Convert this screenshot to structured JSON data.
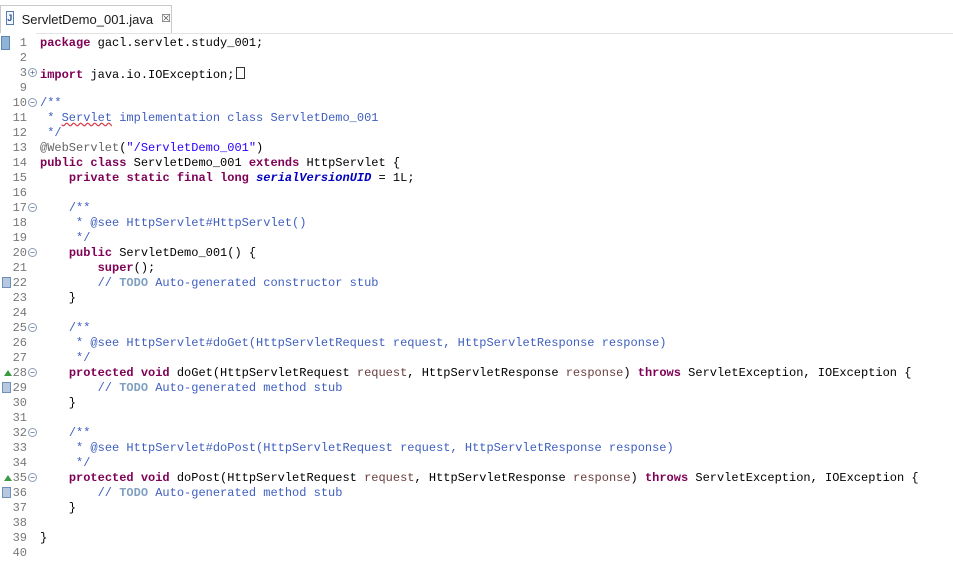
{
  "tab": {
    "label": "ServletDemo_001.java",
    "close": "☒"
  },
  "lines": [
    {
      "n": "1",
      "parts": [
        [
          "kw",
          "package"
        ],
        [
          "",
          "gacl.servlet.study_001;"
        ]
      ]
    },
    {
      "n": "2",
      "parts": []
    },
    {
      "n": "3",
      "parts": [
        [
          "kw",
          "import"
        ],
        [
          "",
          " java.io.IOException;"
        ]
      ],
      "box": true
    },
    {
      "n": "9",
      "parts": []
    },
    {
      "n": "10",
      "parts": [
        [
          "cm",
          "/**"
        ]
      ]
    },
    {
      "n": "11",
      "parts": [
        [
          "cm",
          " * "
        ],
        [
          "cm-err",
          "Servlet"
        ],
        [
          "cm",
          " implementation class ServletDemo_001"
        ]
      ]
    },
    {
      "n": "12",
      "parts": [
        [
          "cm",
          " */"
        ]
      ]
    },
    {
      "n": "13",
      "parts": [
        [
          "ann",
          "@WebServlet"
        ],
        [
          "",
          "("
        ],
        [
          "str",
          "\"/ServletDemo_001\""
        ],
        [
          "",
          ")"
        ]
      ]
    },
    {
      "n": "14",
      "parts": [
        [
          "kw",
          "public"
        ],
        [
          "",
          " "
        ],
        [
          "kw",
          "class"
        ],
        [
          "",
          " ServletDemo_001 "
        ],
        [
          "kw",
          "extends"
        ],
        [
          "",
          " HttpServlet {"
        ]
      ]
    },
    {
      "n": "15",
      "parts": [
        [
          "",
          "    "
        ],
        [
          "kw",
          "private"
        ],
        [
          "",
          " "
        ],
        [
          "kw",
          "static"
        ],
        [
          "",
          " "
        ],
        [
          "kw",
          "final"
        ],
        [
          "",
          " "
        ],
        [
          "kw",
          "long"
        ],
        [
          "",
          " "
        ],
        [
          "fld",
          "serialVersionUID"
        ],
        [
          "",
          " = 1L;"
        ]
      ]
    },
    {
      "n": "16",
      "parts": []
    },
    {
      "n": "17",
      "parts": [
        [
          "",
          "    "
        ],
        [
          "cm",
          "/**"
        ]
      ]
    },
    {
      "n": "18",
      "parts": [
        [
          "",
          "    "
        ],
        [
          "cm",
          " * @see HttpServlet#HttpServlet()"
        ]
      ]
    },
    {
      "n": "19",
      "parts": [
        [
          "",
          "    "
        ],
        [
          "cm",
          " */"
        ]
      ]
    },
    {
      "n": "20",
      "parts": [
        [
          "",
          "    "
        ],
        [
          "kw",
          "public"
        ],
        [
          "",
          " ServletDemo_001() {"
        ]
      ]
    },
    {
      "n": "21",
      "parts": [
        [
          "",
          "        "
        ],
        [
          "kw",
          "super"
        ],
        [
          "",
          "();"
        ]
      ]
    },
    {
      "n": "22",
      "parts": [
        [
          "",
          "        "
        ],
        [
          "cm",
          "// "
        ],
        [
          "todo",
          "TODO"
        ],
        [
          "cm",
          " Auto-generated constructor stub"
        ]
      ]
    },
    {
      "n": "23",
      "parts": [
        [
          "",
          "    }"
        ]
      ]
    },
    {
      "n": "24",
      "parts": []
    },
    {
      "n": "25",
      "parts": [
        [
          "",
          "    "
        ],
        [
          "cm",
          "/**"
        ]
      ]
    },
    {
      "n": "26",
      "parts": [
        [
          "",
          "    "
        ],
        [
          "cm",
          " * @see HttpServlet#doGet(HttpServletRequest request, HttpServletResponse response)"
        ]
      ]
    },
    {
      "n": "27",
      "parts": [
        [
          "",
          "    "
        ],
        [
          "cm",
          " */"
        ]
      ]
    },
    {
      "n": "28",
      "parts": [
        [
          "",
          "    "
        ],
        [
          "kw",
          "protected"
        ],
        [
          "",
          " "
        ],
        [
          "kw",
          "void"
        ],
        [
          "",
          " doGet(HttpServletRequest "
        ],
        [
          "prm",
          "request"
        ],
        [
          "",
          ", HttpServletResponse "
        ],
        [
          "prm",
          "response"
        ],
        [
          "",
          ") "
        ],
        [
          "kw",
          "throws"
        ],
        [
          "",
          " ServletException, IOException {"
        ]
      ]
    },
    {
      "n": "29",
      "parts": [
        [
          "",
          "        "
        ],
        [
          "cm",
          "// "
        ],
        [
          "todo",
          "TODO"
        ],
        [
          "cm",
          " Auto-generated method stub"
        ]
      ]
    },
    {
      "n": "30",
      "parts": [
        [
          "",
          "    }"
        ]
      ]
    },
    {
      "n": "31",
      "parts": []
    },
    {
      "n": "32",
      "parts": [
        [
          "",
          "    "
        ],
        [
          "cm",
          "/**"
        ]
      ]
    },
    {
      "n": "33",
      "parts": [
        [
          "",
          "    "
        ],
        [
          "cm",
          " * @see HttpServlet#doPost(HttpServletRequest request, HttpServletResponse response)"
        ]
      ]
    },
    {
      "n": "34",
      "parts": [
        [
          "",
          "    "
        ],
        [
          "cm",
          " */"
        ]
      ]
    },
    {
      "n": "35",
      "parts": [
        [
          "",
          "    "
        ],
        [
          "kw",
          "protected"
        ],
        [
          "",
          " "
        ],
        [
          "kw",
          "void"
        ],
        [
          "",
          " doPost(HttpServletRequest "
        ],
        [
          "prm",
          "request"
        ],
        [
          "",
          ", HttpServletResponse "
        ],
        [
          "prm",
          "response"
        ],
        [
          "",
          ") "
        ],
        [
          "kw",
          "throws"
        ],
        [
          "",
          " ServletException, IOException {"
        ]
      ]
    },
    {
      "n": "36",
      "parts": [
        [
          "",
          "        "
        ],
        [
          "cm",
          "// "
        ],
        [
          "todo",
          "TODO"
        ],
        [
          "cm",
          " Auto-generated method stub"
        ]
      ]
    },
    {
      "n": "37",
      "parts": [
        [
          "",
          "    }"
        ]
      ]
    },
    {
      "n": "38",
      "parts": []
    },
    {
      "n": "39",
      "parts": [
        [
          "",
          "}"
        ]
      ]
    },
    {
      "n": "40",
      "parts": []
    }
  ],
  "markers": {
    "selection": [
      "1"
    ],
    "fold_plus": [
      "3"
    ],
    "fold_minus": [
      "10",
      "17",
      "20",
      "25",
      "28",
      "32",
      "35"
    ],
    "override": [
      "28",
      "35"
    ],
    "task": [
      "22",
      "29",
      "36"
    ]
  },
  "colors": {
    "keyword": "#7f0055",
    "string": "#2a00ff",
    "comment": "#3f5fbf",
    "annotation": "#646464",
    "field": "#0000c0"
  }
}
